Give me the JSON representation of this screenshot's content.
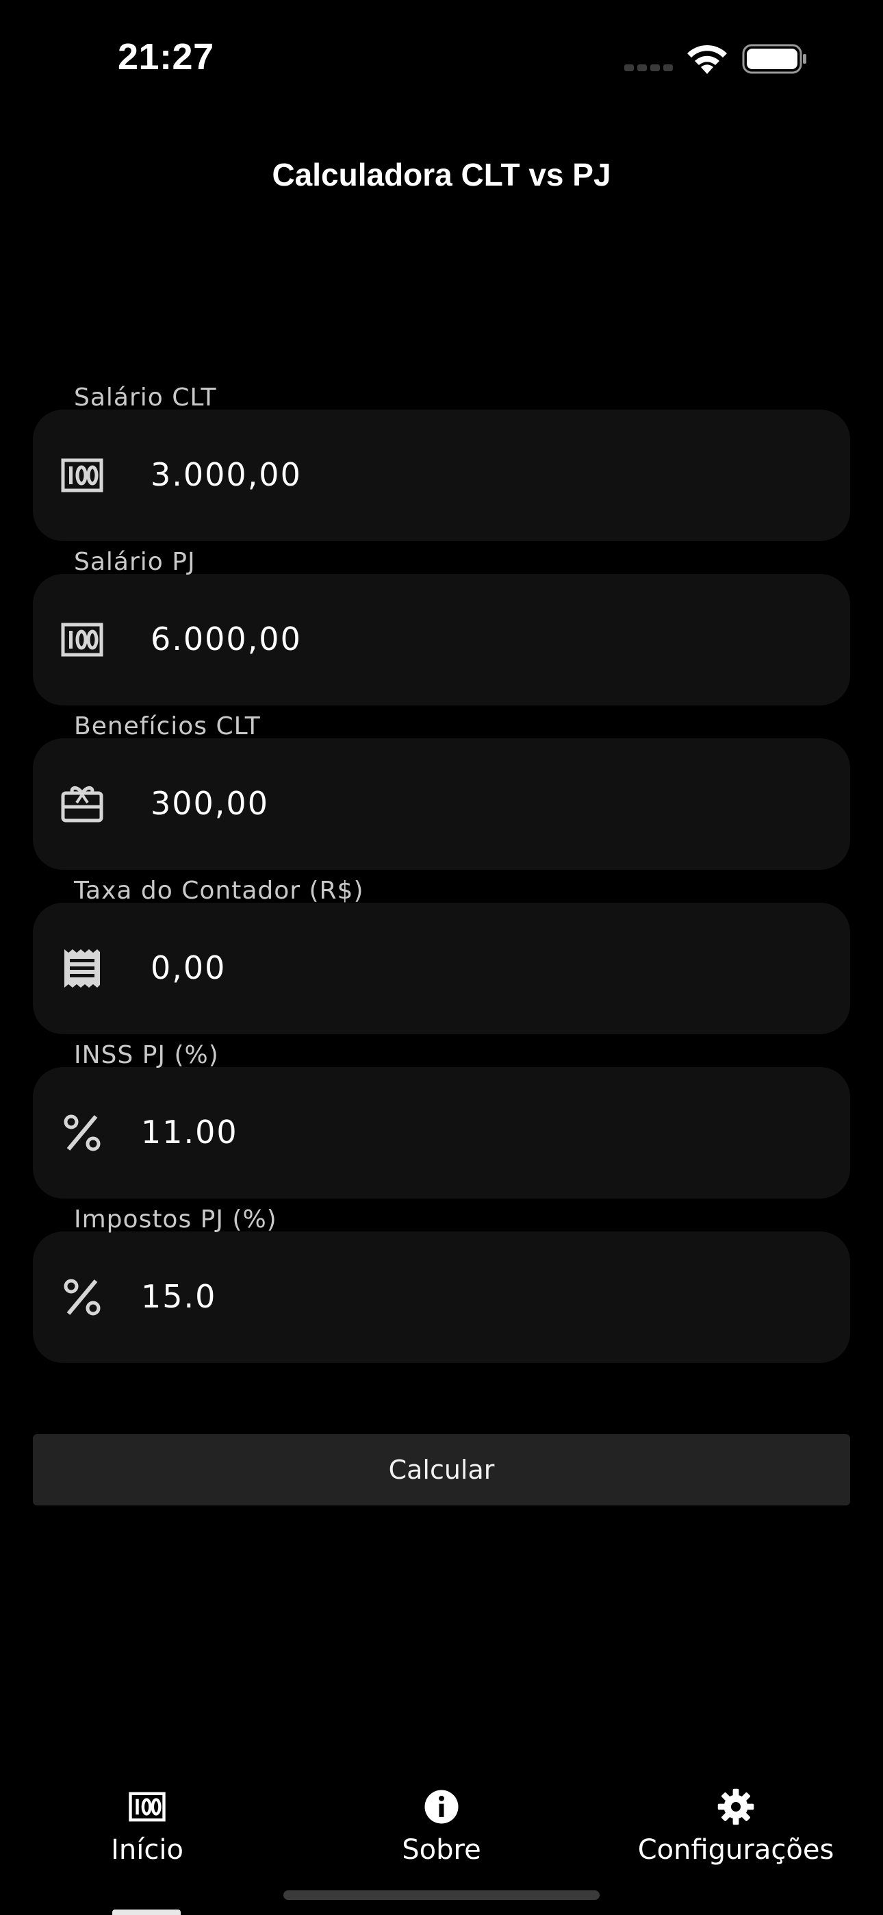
{
  "status_bar": {
    "time": "21:27"
  },
  "header": {
    "title": "Calculadora CLT vs PJ"
  },
  "form": {
    "fields": [
      {
        "label": "Salário CLT",
        "value": "3.000,00",
        "icon": "money-icon"
      },
      {
        "label": "Salário PJ",
        "value": "6.000,00",
        "icon": "money-icon"
      },
      {
        "label": "Benefícios CLT",
        "value": "300,00",
        "icon": "gift-card-icon"
      },
      {
        "label": "Taxa do Contador (R$)",
        "value": "0,00",
        "icon": "receipt-icon"
      },
      {
        "label": "INSS PJ (%)",
        "value": "11.00",
        "icon": "percent-icon"
      },
      {
        "label": "Impostos PJ (%)",
        "value": "15.0",
        "icon": "percent-icon"
      }
    ],
    "calculate_label": "Calcular"
  },
  "bottom_nav": {
    "items": [
      {
        "label": "Início",
        "icon": "money-icon"
      },
      {
        "label": "Sobre",
        "icon": "info-icon"
      },
      {
        "label": "Configurações",
        "icon": "gear-icon"
      }
    ]
  },
  "colors": {
    "background": "#000000",
    "field_background": "#111111",
    "button_background": "#232323",
    "label_color": "#c9c9c9",
    "text_color": "#ffffff"
  }
}
